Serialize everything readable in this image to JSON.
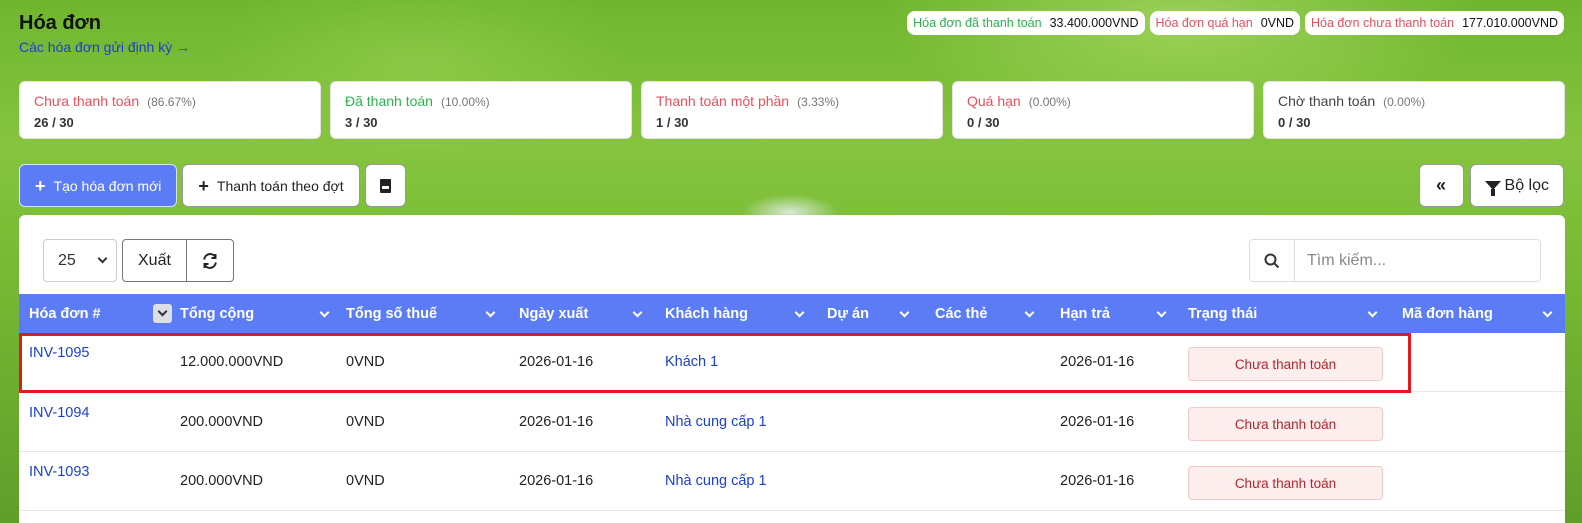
{
  "page": {
    "title": "Hóa đơn",
    "recurring_link": "Các hóa đơn gửi định kỳ →"
  },
  "summary": [
    {
      "label": "Hóa đơn đã thanh toán",
      "value": "33.400.000VND",
      "color": "#2bb34d"
    },
    {
      "label": "Hóa đơn quá hạn",
      "value": "0VND",
      "color": "#e8505b"
    },
    {
      "label": "Hóa đơn chưa thanh toán",
      "value": "177.010.000VND",
      "color": "#e8505b"
    }
  ],
  "stats": [
    {
      "label": "Chưa thanh toán",
      "pct": "(86.67%)",
      "count": "26 / 30",
      "color": "#e8505b"
    },
    {
      "label": "Đã thanh toán",
      "pct": "(10.00%)",
      "count": "3 / 30",
      "color": "#2bb34d"
    },
    {
      "label": "Thanh toán một phần",
      "pct": "(3.33%)",
      "count": "1 / 30",
      "color": "#e8505b"
    },
    {
      "label": "Quá hạn",
      "pct": "(0.00%)",
      "count": "0 / 30",
      "color": "#e8505b"
    },
    {
      "label": "Chờ thanh toán",
      "pct": "(0.00%)",
      "count": "0 / 30",
      "color": "#444444"
    }
  ],
  "toolbar": {
    "create_invoice": "Tạo hóa đơn mới",
    "batch_payment": "Thanh toán theo đợt",
    "pdf_icon": "pdf-icon",
    "filter": "Bộ lọc",
    "collapse_icon": "double-chevron-left-icon"
  },
  "table_controls": {
    "page_size": "25",
    "export": "Xuất",
    "refresh_icon": "refresh-icon",
    "search_placeholder": "Tìm kiếm..."
  },
  "columns": [
    "Hóa đơn #",
    "Tổng cộng",
    "Tổng số thuế",
    "Ngày xuất",
    "Khách hàng",
    "Dự án",
    "Các thẻ",
    "Hạn trả",
    "Trạng thái",
    "Mã đơn hàng"
  ],
  "rows": [
    {
      "invoice": "INV-1095",
      "total": "12.000.000VND",
      "tax": "0VND",
      "date": "2026-01-16",
      "customer": "Khách 1",
      "project": "",
      "tags": "",
      "due": "2026-01-16",
      "status": "Chưa thanh toán",
      "order": ""
    },
    {
      "invoice": "INV-1094",
      "total": "200.000VND",
      "tax": "0VND",
      "date": "2026-01-16",
      "customer": "Nhà cung cấp 1",
      "project": "",
      "tags": "",
      "due": "2026-01-16",
      "status": "Chưa thanh toán",
      "order": ""
    },
    {
      "invoice": "INV-1093",
      "total": "200.000VND",
      "tax": "0VND",
      "date": "2026-01-16",
      "customer": "Nhà cung cấp 1",
      "project": "",
      "tags": "",
      "due": "2026-01-16",
      "status": "Chưa thanh toán",
      "order": ""
    }
  ],
  "colors": {
    "accent": "#5b7cf5",
    "link": "#1a3fd4",
    "highlight": "#e21a1a",
    "status_unpaid_bg": "#fdeeee",
    "status_unpaid_text": "#b3262d"
  }
}
